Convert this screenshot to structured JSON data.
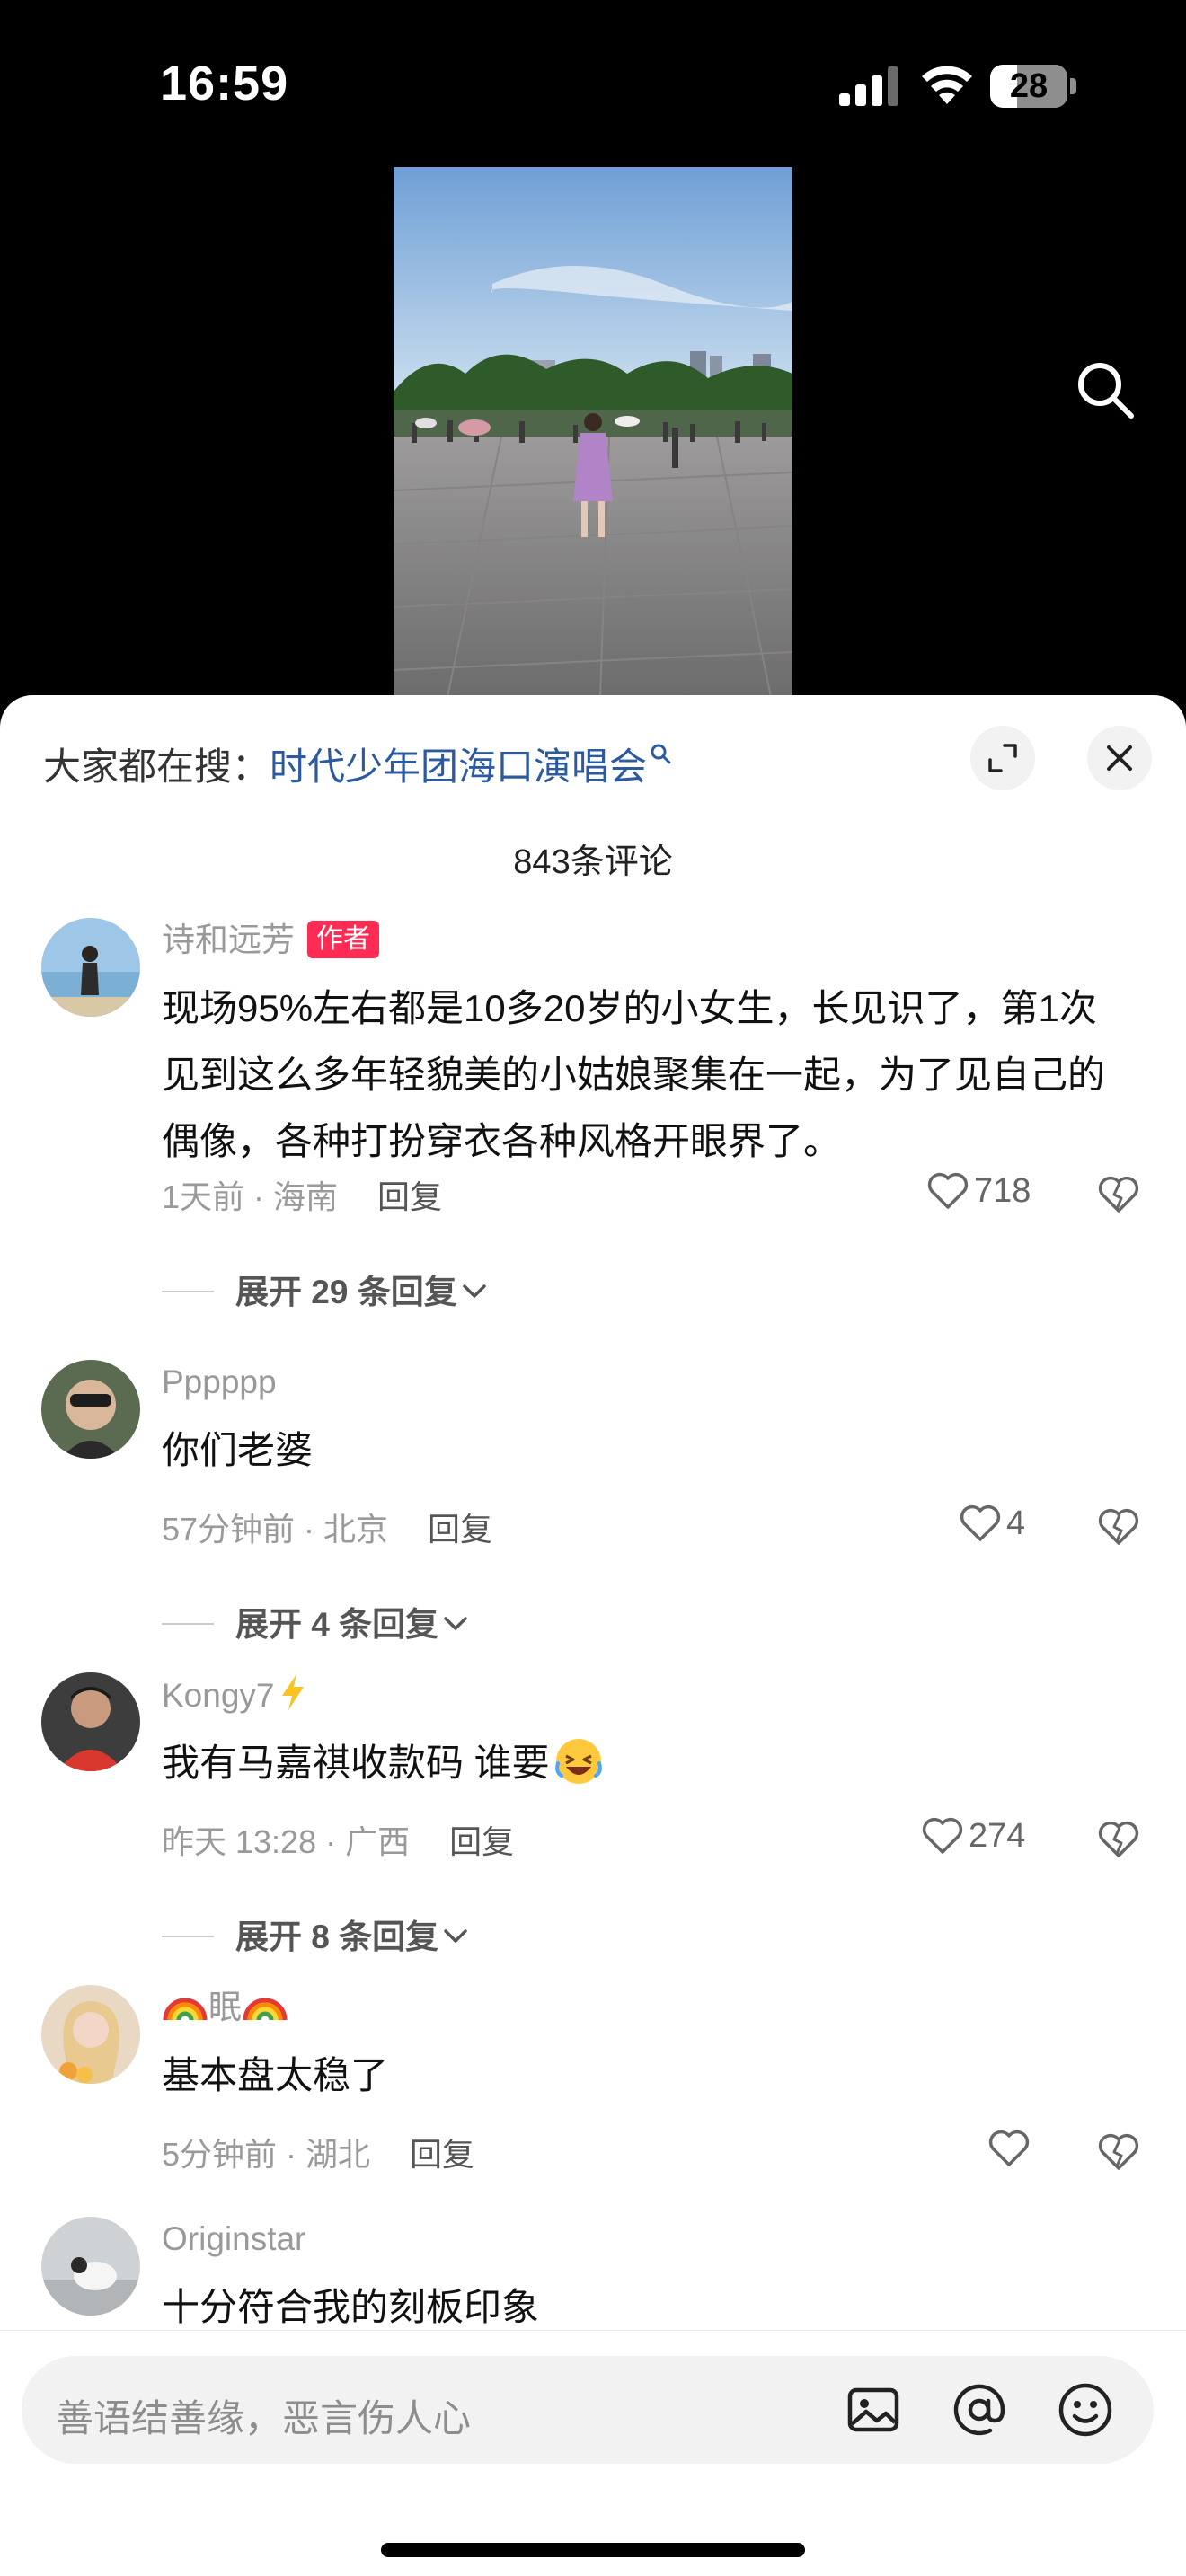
{
  "status_bar": {
    "time": "16:59",
    "battery_level": "28"
  },
  "sheet": {
    "search_hint_prefix": "大家都在搜：",
    "search_hint_link": "时代少年团海口演唱会",
    "comment_count": "843条评论"
  },
  "comments": [
    {
      "name": "诗和远芳",
      "badge": "作者",
      "text": "现场95%左右都是10多20岁的小女生，长见识了，第1次见到这么多年轻貌美的小姑娘聚集在一起，为了见自己的偶像，各种打扮穿衣各种风格开眼界了。",
      "meta": "1天前 · 海南",
      "reply": "回复",
      "likes": "718",
      "expand": "展开 29 条回复"
    },
    {
      "name": "Pppppp",
      "text": "你们老婆",
      "meta": "57分钟前 · 北京",
      "reply": "回复",
      "likes": "4",
      "expand": "展开 4 条回复"
    },
    {
      "name": "Kongy7",
      "text": "我有马嘉祺收款码  谁要",
      "meta": "昨天 13:28 · 广西",
      "reply": "回复",
      "likes": "274",
      "expand": "展开 8 条回复"
    },
    {
      "name": "眠",
      "text": "基本盘太稳了",
      "meta": "5分钟前 · 湖北",
      "reply": "回复",
      "likes": ""
    },
    {
      "name": "Originstar",
      "text": "十分符合我的刻板印象"
    }
  ],
  "input": {
    "placeholder": "善语结善缘，恶言伤人心"
  },
  "icons": {
    "signal": "signal-icon",
    "wifi": "wifi-icon",
    "battery": "battery-icon",
    "search": "search-icon",
    "expand": "expand-icon",
    "close": "close-icon",
    "heart": "heart-icon",
    "broken_heart": "broken-heart-icon",
    "chevron": "chevron-down-icon",
    "image": "image-icon",
    "mention": "at-icon",
    "emoji": "emoji-icon"
  },
  "colors": {
    "author_badge": "#fe2c55",
    "search_link": "#2c5aa0"
  }
}
